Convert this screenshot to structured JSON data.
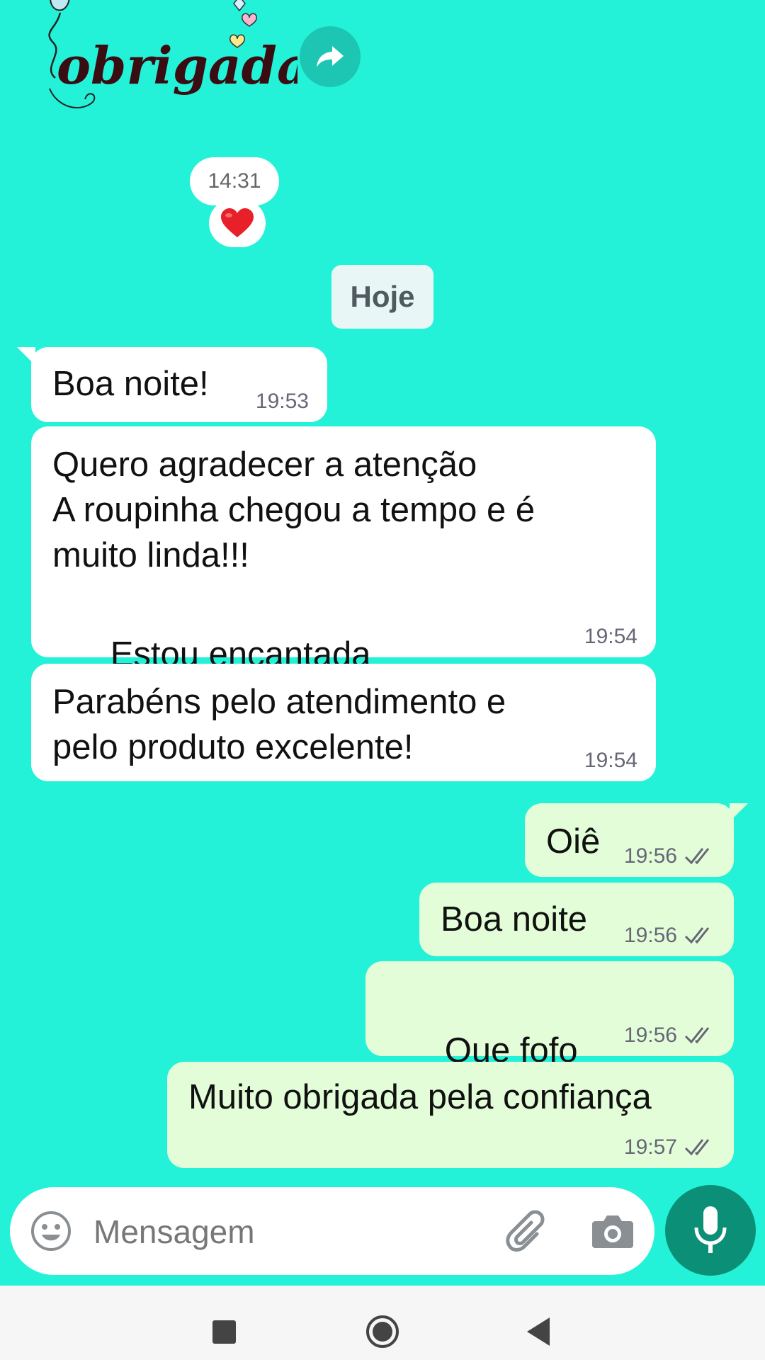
{
  "sticker": {
    "text": "obrigada!"
  },
  "reaction_block": {
    "time": "14:31",
    "reaction": "❤️"
  },
  "date_chip": "Hoje",
  "messages": [
    {
      "dir": "in",
      "text": "Boa noite!",
      "time": "19:53"
    },
    {
      "dir": "in",
      "text": "Quero agradecer a atenção\nA roupinha chegou a tempo e é\nmuito linda!!!",
      "text2": "Estou encantada",
      "emoji": "😍",
      "time": "19:54"
    },
    {
      "dir": "in",
      "text": "Parabéns pelo atendimento e\npelo produto excelente!",
      "time": "19:54"
    },
    {
      "dir": "out",
      "text": "Oiê",
      "time": "19:56",
      "status": "read"
    },
    {
      "dir": "out",
      "text": "Boa noite",
      "time": "19:56",
      "status": "read"
    },
    {
      "dir": "out",
      "text": "Que fofo",
      "emoji": "❤️",
      "time": "19:56",
      "status": "read"
    },
    {
      "dir": "out",
      "text": "Muito obrigada pela confiança",
      "time": "19:57",
      "status": "read"
    }
  ],
  "input": {
    "placeholder": "Mensagem"
  },
  "icons": {
    "forward": "forward-icon",
    "emoji": "emoji-icon",
    "attach": "paperclip-icon",
    "camera": "camera-icon",
    "mic": "mic-icon"
  },
  "colors": {
    "wallpaper": "#23f2d9",
    "incoming": "#ffffff",
    "outgoing": "#e2fdd8",
    "mic_button": "#0c8f77"
  }
}
